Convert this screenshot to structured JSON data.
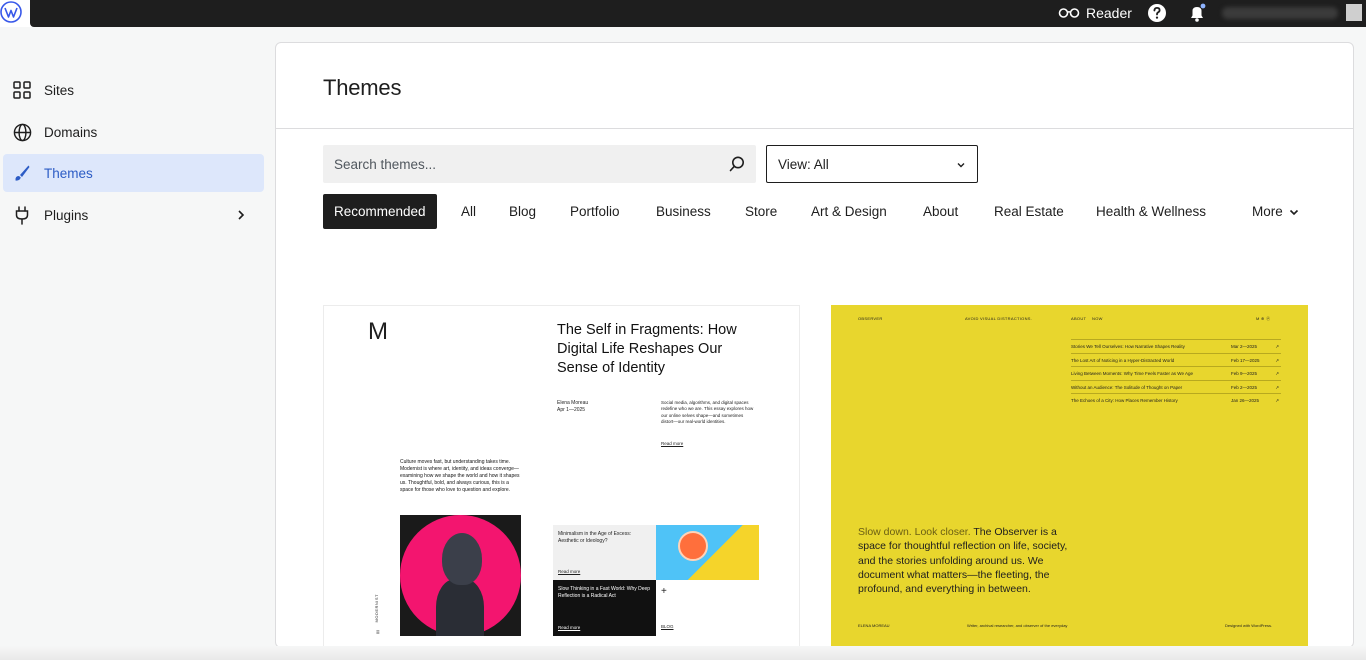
{
  "topbar": {
    "reader_label": "Reader"
  },
  "sidebar": {
    "items": [
      {
        "label": "Sites",
        "icon": "grid-icon"
      },
      {
        "label": "Domains",
        "icon": "globe-icon"
      },
      {
        "label": "Themes",
        "icon": "brush-icon",
        "active": true
      },
      {
        "label": "Plugins",
        "icon": "plug-icon"
      }
    ]
  },
  "main": {
    "title": "Themes",
    "search": {
      "placeholder": "Search themes..."
    },
    "view_select": {
      "value": "View: All"
    },
    "tabs": [
      "Recommended",
      "All",
      "Blog",
      "Portfolio",
      "Business",
      "Store",
      "Art & Design",
      "About",
      "Real Estate",
      "Health & Wellness",
      "More"
    ],
    "active_tab": "Recommended"
  },
  "cards": {
    "modernist": {
      "logo": "M",
      "headline": "The Self in Fragments: How Digital Life Reshapes Our Sense of Identity",
      "author": "Elena Moreau",
      "date": "Apr 1—2025",
      "excerpt": "Social media, algorithms, and digital spaces redefine who we are. This essay explores how our online selves shape—and sometimes distort—our real-world identities.",
      "read_more": "Read more",
      "intro": "Culture moves fast, but understanding takes time. Modernist is where art, identity, and ideas converge—examining how we shape the world and how it shapes us. Thoughtful, bold, and always curious, this is a space for those who love to question and explore.",
      "side_label": "MODERNIST",
      "menu_icon": "≡",
      "tile1": "Minimalism in the Age of Excess: Aesthetic or Ideology?",
      "tile2": "Slow Thinking in a Fast World: Why Deep Reflection is a Radical Act",
      "plus": "+",
      "blog": "BLOG"
    },
    "observer": {
      "brand": "OBSERVER",
      "tagline": "AVOID VISUAL DISTRACTIONS.",
      "nav_about": "ABOUT",
      "nav_now": "NOW",
      "social": "M  ⊕  ⓟ",
      "posts": [
        {
          "title": "Stories We Tell Ourselves: How Narrative Shapes Reality",
          "date": "Mar 2—2025",
          "arrow": "↗"
        },
        {
          "title": "The Lost Art of Noticing in a Hyper-Distracted World",
          "date": "Feb 17—2025",
          "arrow": "↗"
        },
        {
          "title": "Living Between Moments: Why Time Feels Faster as We Age",
          "date": "Feb 9—2025",
          "arrow": "↗"
        },
        {
          "title": "Without an Audience: The Solitude of Thought on Paper",
          "date": "Feb 2—2025",
          "arrow": "↗"
        },
        {
          "title": "The Echoes of a City: How Places Remember History",
          "date": "Jan 26—2025",
          "arrow": "↗"
        }
      ],
      "intro_muted": "Slow down. Look closer.",
      "intro_rest": " The Observer is a space for thoughtful reflection on life, society, and the stories unfolding around us. We document what matters—the fleeting, the profound, and everything in between.",
      "foot_name": "ELENA MOREAU",
      "foot_bio": "Writer, archival researcher, and observer of the everyday",
      "foot_credit": "Designed with WordPress."
    }
  },
  "colors": {
    "active_bg": "#dde7fb",
    "active_text": "#2c5cc5",
    "observer_yellow": "#e8d62d",
    "modernist_pink": "#f3156f"
  }
}
